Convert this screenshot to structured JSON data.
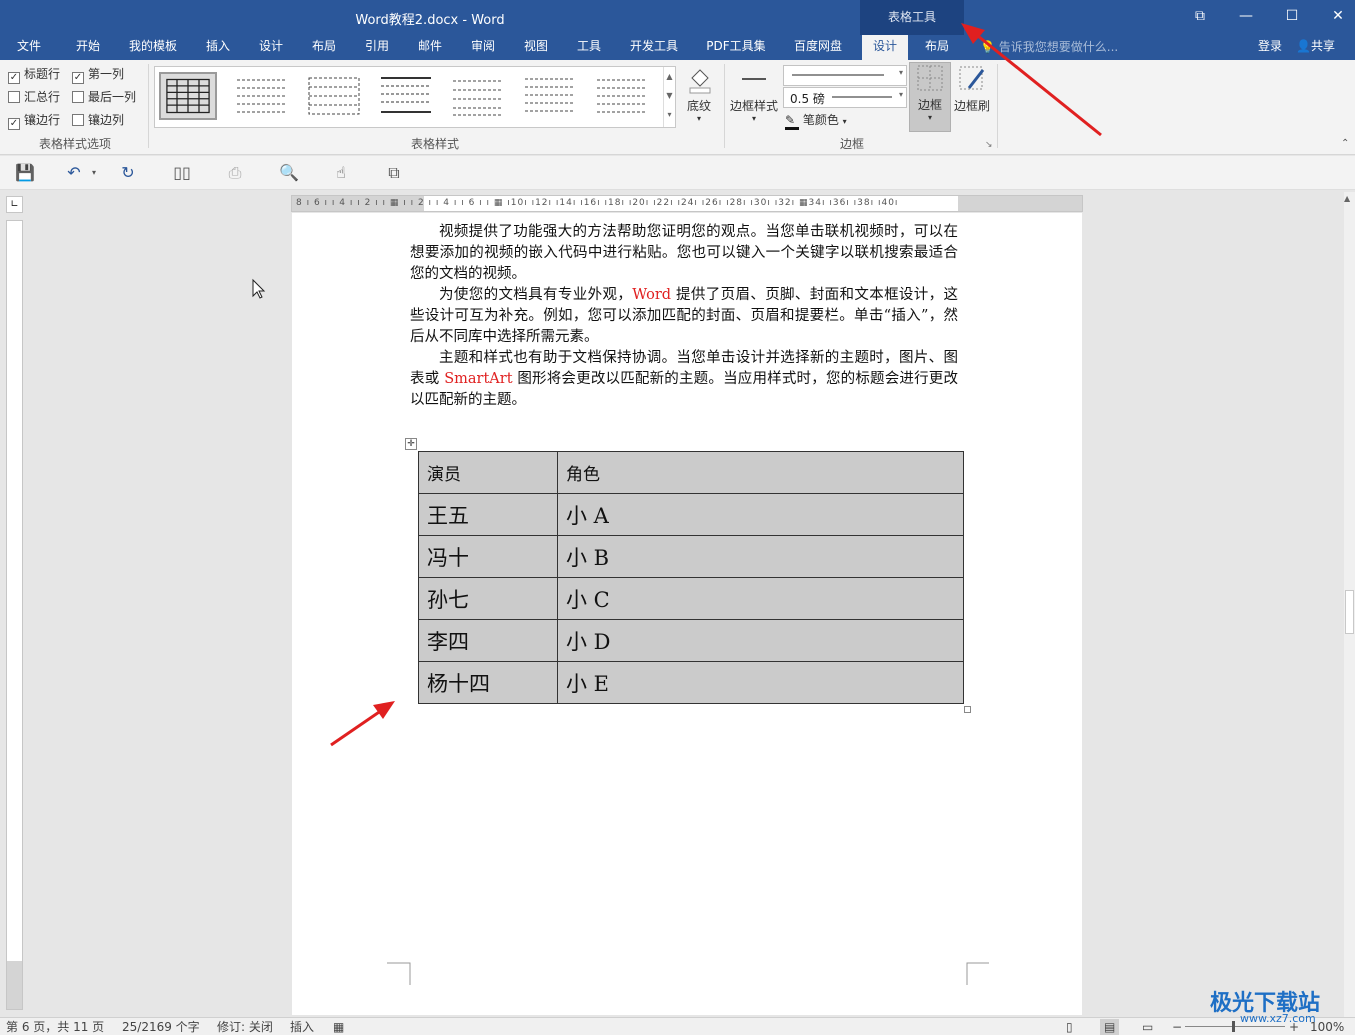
{
  "window": {
    "title": "Word教程2.docx - Word",
    "context_tab": "表格工具"
  },
  "menu": {
    "tabs": [
      "文件",
      "开始",
      "我的模板",
      "插入",
      "设计",
      "布局",
      "引用",
      "邮件",
      "审阅",
      "视图",
      "工具",
      "开发工具",
      "PDF工具集",
      "百度网盘",
      "设计",
      "布局"
    ],
    "active_index": 14,
    "tell_me": "告诉我您想要做什么...",
    "login": "登录",
    "share": "共享"
  },
  "ribbon": {
    "style_options": {
      "label": "表格样式选项",
      "items": [
        {
          "label": "标题行",
          "checked": true
        },
        {
          "label": "第一列",
          "checked": true
        },
        {
          "label": "汇总行",
          "checked": false
        },
        {
          "label": "最后一列",
          "checked": false
        },
        {
          "label": "镶边行",
          "checked": true
        },
        {
          "label": "镶边列",
          "checked": false
        }
      ]
    },
    "table_styles": {
      "label": "表格样式"
    },
    "shading": "底纹",
    "border_styles": "边框样式",
    "pen_weight": "0.5 磅",
    "pen_color": "笔颜色",
    "borders": "边框",
    "border_painter": "边框刷",
    "borders_group_label": "边框"
  },
  "document": {
    "paragraphs": [
      {
        "parts": [
          {
            "t": "视频提供了功能强大的方法帮助您证明您的观点。当您单击联机视频时，可以在想要添加的视频的嵌入代码中进行粘贴。您也可以键入一个关键字以联机搜索最适合您的文档的视频。"
          }
        ]
      },
      {
        "parts": [
          {
            "t": "为使您的文档具有专业外观，"
          },
          {
            "t": "Word",
            "red": true
          },
          {
            "t": " 提供了页眉、页脚、封面和文本框设计，这些设计可互为补充。例如，您可以添加匹配的封面、页眉和提要栏。单击“插入”，然后从不同库中选择所需元素。"
          }
        ]
      },
      {
        "parts": [
          {
            "t": "主题和样式也有助于文档保持协调。当您单击设计并选择新的主题时，图片、图表或 "
          },
          {
            "t": "SmartArt",
            "red": true
          },
          {
            "t": " 图形将会更改以匹配新的主题。当应用样式时，您的标题会进行更改以匹配新的主题。"
          }
        ]
      }
    ],
    "table": {
      "header": [
        "演员",
        "角色"
      ],
      "rows": [
        [
          "王五",
          "小 A"
        ],
        [
          "冯十",
          "小 B"
        ],
        [
          "孙七",
          "小 C"
        ],
        [
          "李四",
          "小 D"
        ],
        [
          "杨十四",
          "小 E"
        ]
      ]
    }
  },
  "status": {
    "page": "第 6 页，共 11 页",
    "words": "25/2169 个字",
    "track": "修订: 关闭",
    "mode": "插入",
    "zoom": "100%"
  },
  "watermark": {
    "name": "极光下载站",
    "url": "www.xz7.com"
  },
  "colors": {
    "brand": "#2b579a",
    "context": "#1d4380",
    "arrow": "#e02020"
  }
}
